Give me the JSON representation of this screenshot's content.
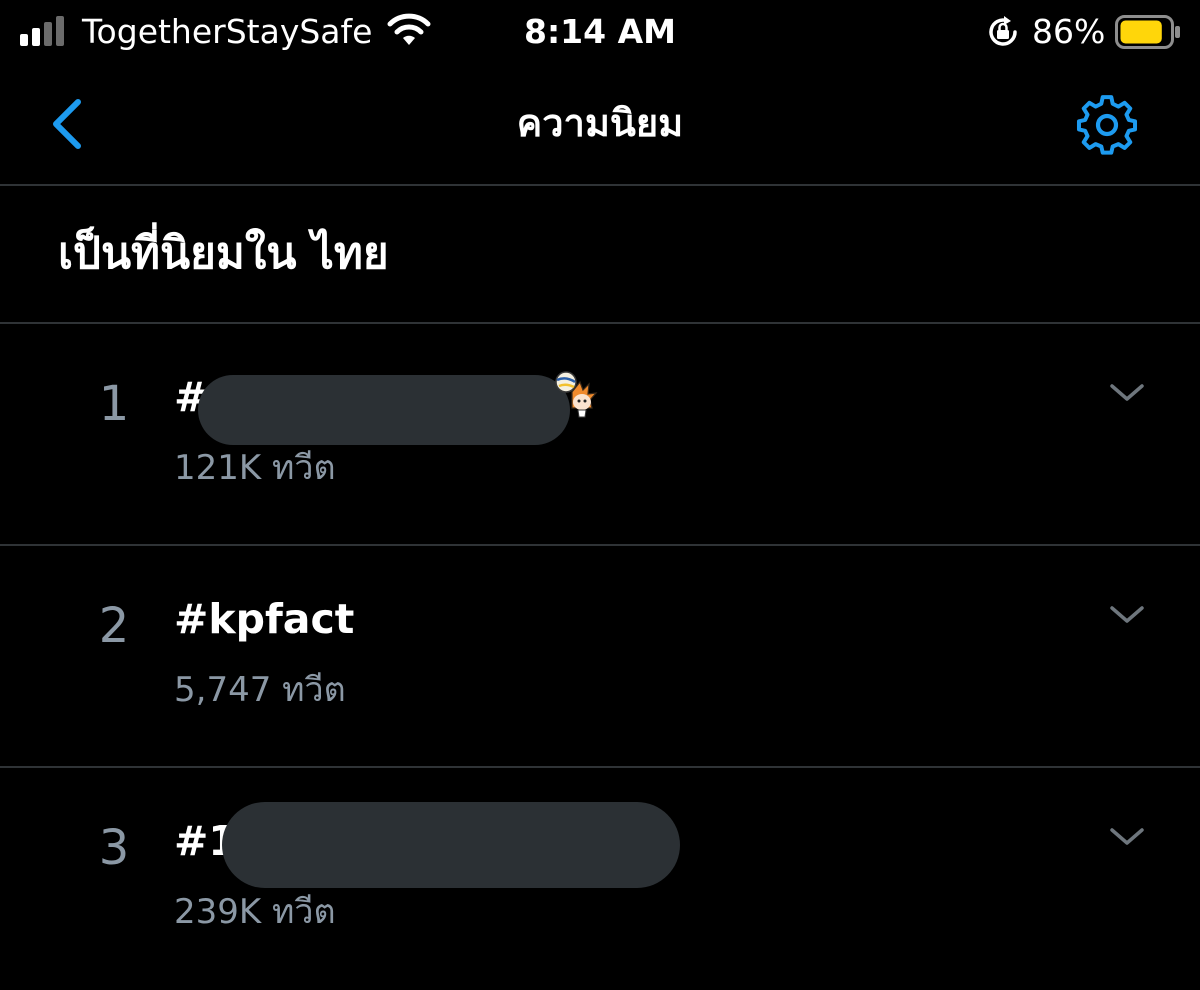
{
  "status_bar": {
    "carrier": "TogetherStaySafe",
    "time": "8:14 AM",
    "battery_percent": "86%",
    "battery_level": 0.86,
    "signal_bars_active": 2,
    "signal_bars_total": 4,
    "icons": [
      "signal-icon",
      "wifi-icon",
      "rotation-lock-icon",
      "battery-icon"
    ]
  },
  "nav": {
    "title": "ความนิยม",
    "back_icon": "chevron-left-icon",
    "settings_icon": "gear-icon"
  },
  "section": {
    "title": "เป็นที่นิยมใน ไทย"
  },
  "trends": [
    {
      "rank": "1",
      "name": "#",
      "count": "121K ทวีต",
      "redacted": true
    },
    {
      "rank": "2",
      "name": "#kpfact",
      "count": "5,747 ทวีต",
      "redacted": false
    },
    {
      "rank": "3",
      "name": "#1",
      "count": "239K ทวีต",
      "redacted": true
    }
  ],
  "colors": {
    "background": "#000000",
    "accent": "#1d9bf0",
    "text_primary": "#ffffff",
    "text_secondary": "#8b98a5",
    "divider": "#2f3336",
    "redaction": "#2b3034",
    "battery": "#ffd60a"
  }
}
